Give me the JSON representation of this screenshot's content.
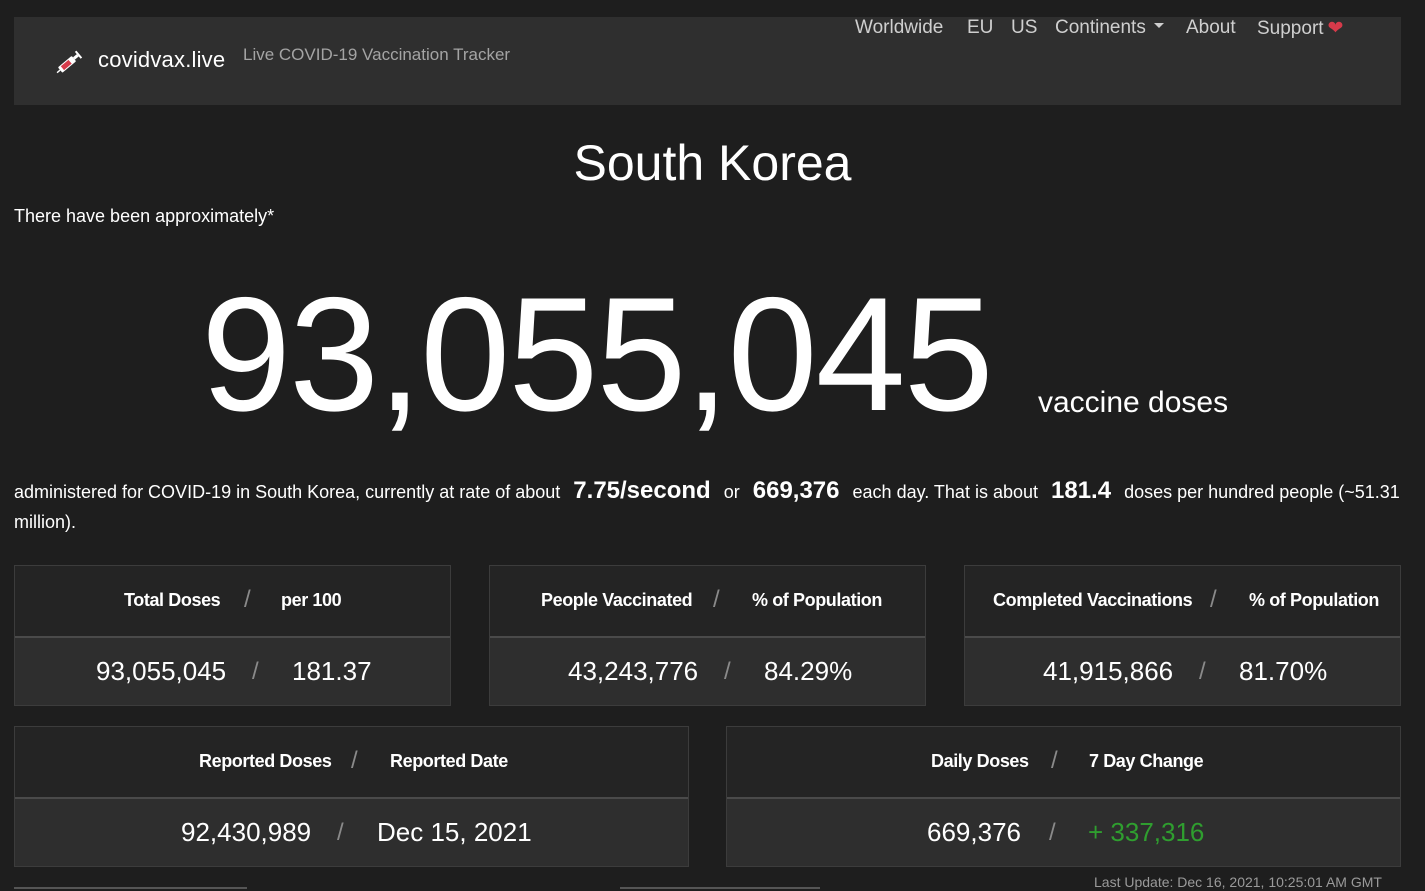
{
  "nav": {
    "brand": "covidvax.live",
    "tagline": "Live COVID-19 Vaccination Tracker",
    "links": [
      "Worldwide",
      "EU",
      "US",
      "Continents",
      "About",
      "Support"
    ],
    "support_heart": "❤"
  },
  "main": {
    "title": "South Korea",
    "intro": "There have been approximately*",
    "big_number": "93,055,045",
    "big_unit": "vaccine doses",
    "sentence": {
      "part1": "administered for COVID-19 in South Korea, currently at rate of about",
      "rate": "7.75/second",
      "or": "or",
      "daily": "669,376",
      "part2": "each day.  That is about",
      "per_hundred": "181.4",
      "part3": "doses per hundred people (~51.31 million)."
    }
  },
  "cards": [
    {
      "label_a": "Total Doses",
      "label_b": "per 100",
      "value_a": "93,055,045",
      "value_b": "181.37"
    },
    {
      "label_a": "People Vaccinated",
      "label_b": "% of Population",
      "value_a": "43,243,776",
      "value_b": "84.29%"
    },
    {
      "label_a": "Completed Vaccinations",
      "label_b": "% of Population",
      "value_a": "41,915,866",
      "value_b": "81.70%"
    },
    {
      "label_a": "Reported Doses",
      "label_b": "Reported Date",
      "value_a": "92,430,989",
      "value_b": "Dec 15, 2021"
    },
    {
      "label_a": "Daily Doses",
      "label_b": "7 Day Change",
      "value_a": "669,376",
      "value_b": "+ 337,316"
    }
  ],
  "separator": "/",
  "footer": {
    "last_update": "Last Update: Dec 16, 2021, 10:25:01 AM GMT"
  },
  "colors": {
    "background": "#1e1e1e",
    "navbar": "#2f2f2f",
    "positive_change": "#2f9e2f",
    "heart": "#d63a4a"
  }
}
